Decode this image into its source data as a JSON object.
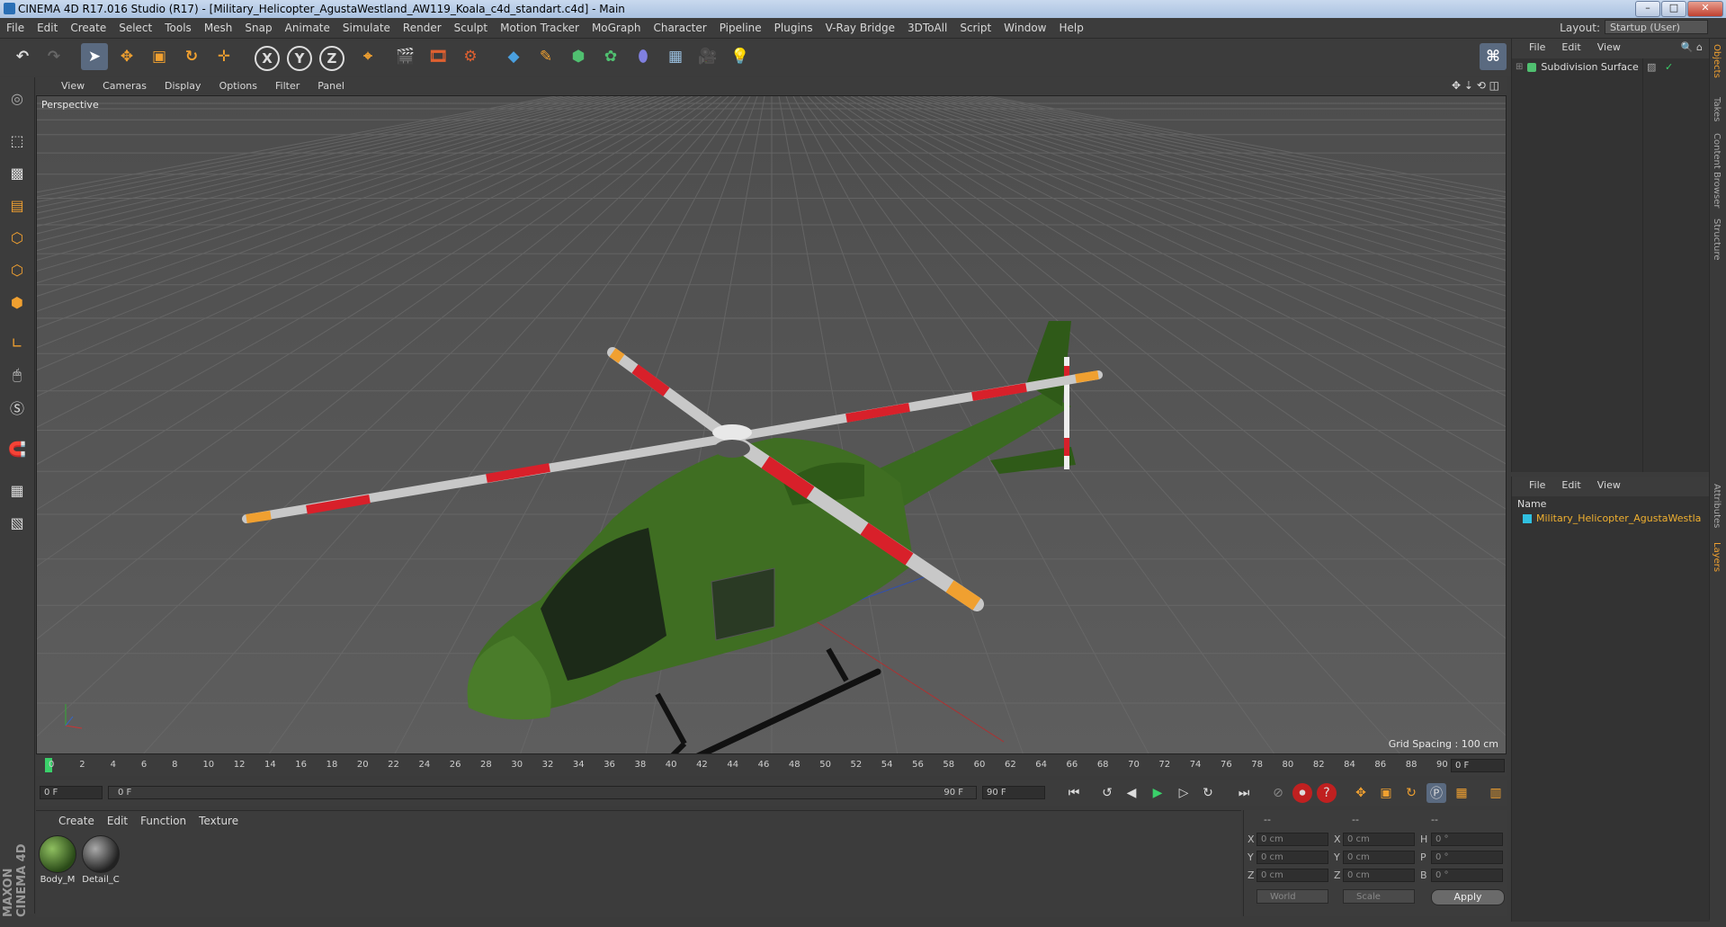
{
  "window": {
    "title": "CINEMA 4D R17.016 Studio (R17) - [Military_Helicopter_AgustaWestland_AW119_Koala_c4d_standart.c4d] - Main",
    "controls": [
      "–",
      "□",
      "✕"
    ]
  },
  "menubar": {
    "items": [
      "File",
      "Edit",
      "Create",
      "Select",
      "Tools",
      "Mesh",
      "Snap",
      "Animate",
      "Simulate",
      "Render",
      "Sculpt",
      "Motion Tracker",
      "MoGraph",
      "Character",
      "Pipeline",
      "Plugins",
      "V-Ray Bridge",
      "3DToAll",
      "Script",
      "Window",
      "Help"
    ],
    "layout_label": "Layout:",
    "layout_value": "Startup (User)"
  },
  "toolbar": {
    "axis_x": "X",
    "axis_y": "Y",
    "axis_z": "Z"
  },
  "viewport": {
    "menu": [
      "View",
      "Cameras",
      "Display",
      "Options",
      "Filter",
      "Panel"
    ],
    "label": "Perspective",
    "grid_spacing": "Grid Spacing : 100 cm"
  },
  "timeline": {
    "ticks": [
      "0",
      "2",
      "4",
      "6",
      "8",
      "10",
      "12",
      "14",
      "16",
      "18",
      "20",
      "22",
      "24",
      "26",
      "28",
      "30",
      "32",
      "34",
      "36",
      "38",
      "40",
      "42",
      "44",
      "46",
      "48",
      "50",
      "52",
      "54",
      "56",
      "58",
      "60",
      "62",
      "64",
      "66",
      "68",
      "70",
      "72",
      "74",
      "76",
      "78",
      "80",
      "82",
      "84",
      "86",
      "88",
      "90"
    ],
    "current_frame": "0 F"
  },
  "transport": {
    "start_field": "0 F",
    "range_start": "0 F",
    "range_end": "90 F",
    "end_field": "90 F"
  },
  "material_manager": {
    "menu": [
      "Create",
      "Edit",
      "Function",
      "Texture"
    ],
    "materials": [
      {
        "name": "Body_M"
      },
      {
        "name": "Detail_C"
      }
    ]
  },
  "coordinates": {
    "header": [
      "--",
      "--",
      "--"
    ],
    "rows": [
      {
        "axis": "X",
        "pos": "0 cm",
        "axis2": "X",
        "size": "0 cm",
        "rot_axis": "H",
        "rot": "0 °"
      },
      {
        "axis": "Y",
        "pos": "0 cm",
        "axis2": "Y",
        "size": "0 cm",
        "rot_axis": "P",
        "rot": "0 °"
      },
      {
        "axis": "Z",
        "pos": "0 cm",
        "axis2": "Z",
        "size": "0 cm",
        "rot_axis": "B",
        "rot": "0 °"
      }
    ],
    "mode_world": "World",
    "mode_scale": "Scale",
    "apply_label": "Apply"
  },
  "object_manager": {
    "menu": [
      "File",
      "Edit",
      "View"
    ],
    "objects": [
      {
        "name": "Subdivision Surface"
      }
    ]
  },
  "layer_manager": {
    "menu": [
      "File",
      "Edit",
      "View"
    ],
    "column_header": "Name",
    "layers": [
      {
        "name": "Military_Helicopter_AgustaWestla"
      }
    ]
  },
  "side_tabs": [
    "Objects",
    "Takes",
    "Content Browser",
    "Structure",
    "Attributes",
    "Layers"
  ],
  "branding": "MAXON CINEMA 4D",
  "colors": {
    "accent_orange": "#f0a030",
    "helicopter_green": "#3f6e22",
    "rotor_red": "#d8202a",
    "layer_text": "#f0b030"
  }
}
